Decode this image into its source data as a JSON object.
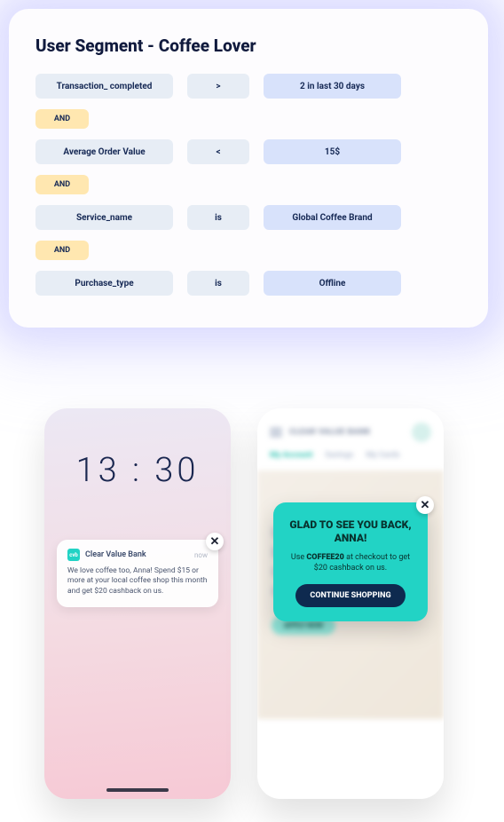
{
  "panel": {
    "title": "User Segment - Coffee Lover",
    "and_label": "AND",
    "rules": [
      {
        "attr": "Transaction_ completed",
        "op": ">",
        "val": "2  in last 30 days"
      },
      {
        "attr": "Average Order Value",
        "op": "<",
        "val": "15$"
      },
      {
        "attr": "Service_name",
        "op": "is",
        "val": "Global Coffee Brand"
      },
      {
        "attr": "Purchase_type",
        "op": "is",
        "val": "Offline"
      }
    ]
  },
  "phone1": {
    "clock": "13 : 30",
    "notification": {
      "app_icon_text": "cvb",
      "app_name": "Clear Value Bank",
      "time_label": "now",
      "body": "We love coffee too, Anna! Spend $15 or more at your local coffee shop this month and get $20 cashback on us."
    }
  },
  "phone2": {
    "header_title": "CLEAR VALUE BANK",
    "tabs": [
      "My Account",
      "Savings",
      "My Cards"
    ],
    "active_tab_index": 0,
    "hero_text": "Up to 24% cash back with the Clear Value Bank Gold card.",
    "apply_label": "APPLY NOW",
    "popup": {
      "title": "GLAD TO SEE YOU BACK, ANNA!",
      "body_prefix": "Use ",
      "code": "COFFEE20",
      "body_suffix": " at checkout to get $20 cashback on us.",
      "cta": "CONTINUE SHOPPING"
    }
  },
  "close_glyph": "✕"
}
